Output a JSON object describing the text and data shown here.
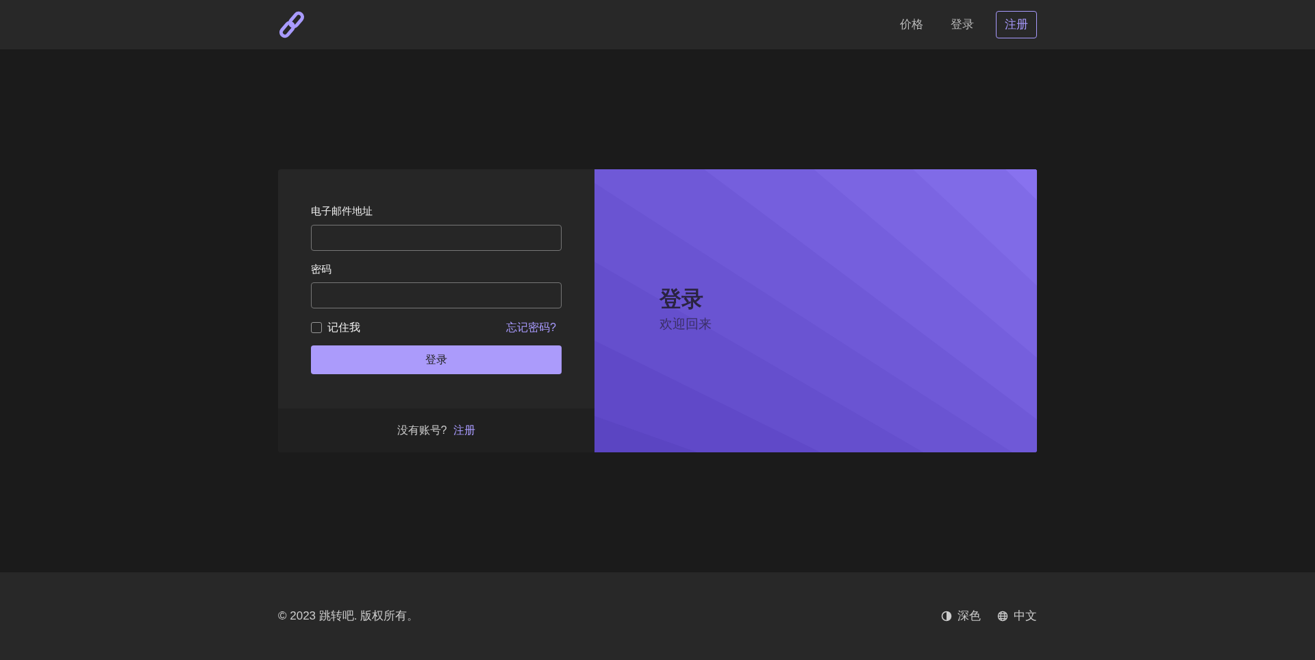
{
  "header": {
    "nav": [
      {
        "label": "价格",
        "kind": "link"
      },
      {
        "label": "登录",
        "kind": "link"
      },
      {
        "label": "注册",
        "kind": "outline"
      }
    ]
  },
  "login_form": {
    "fields": [
      {
        "label": "电子邮件地址"
      },
      {
        "label": "密码"
      }
    ],
    "remember": {
      "label": "记住我",
      "checked": false
    },
    "forgot_link": "忘记密码?",
    "submit": "登录",
    "footer_text": "没有账号?",
    "footer_link": "注册"
  },
  "banner": {
    "title": "登录",
    "subtitle": "欢迎回来"
  },
  "footer": {
    "copyright": "© 2023 跳转吧. 版权所有。",
    "theme": "深色",
    "language": "中文"
  }
}
